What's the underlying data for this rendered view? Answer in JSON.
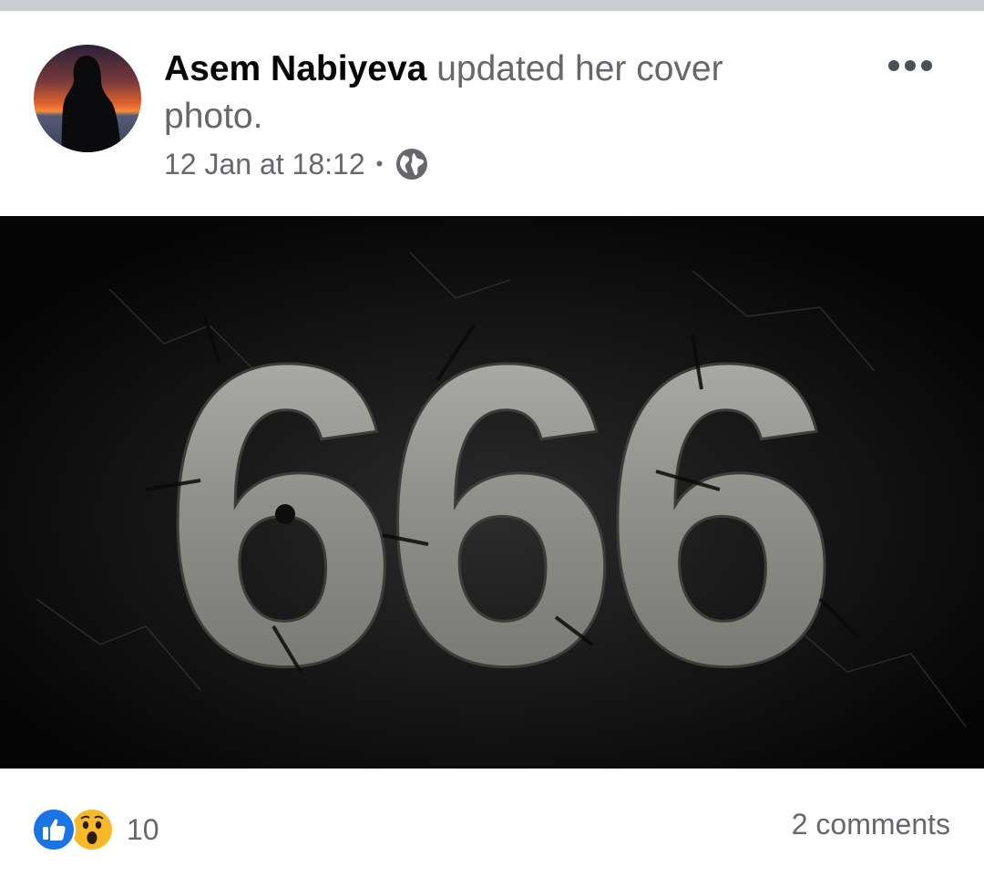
{
  "post": {
    "author": "Asem Nabiyeva",
    "action": "updated her cover photo.",
    "timestamp": "12 Jan at 18:12",
    "separator": "•",
    "audience_icon": "globe-icon",
    "menu_icon": "more-options-icon",
    "cover_image_text": "666"
  },
  "footer": {
    "reaction_icons": [
      "like-icon",
      "wow-icon"
    ],
    "reaction_count": "10",
    "comments": "2 comments"
  },
  "colors": {
    "like_blue": "#1b74e4",
    "wow_yellow": "#f7b928",
    "secondary_text": "#65676b",
    "primary_text": "#050505"
  }
}
